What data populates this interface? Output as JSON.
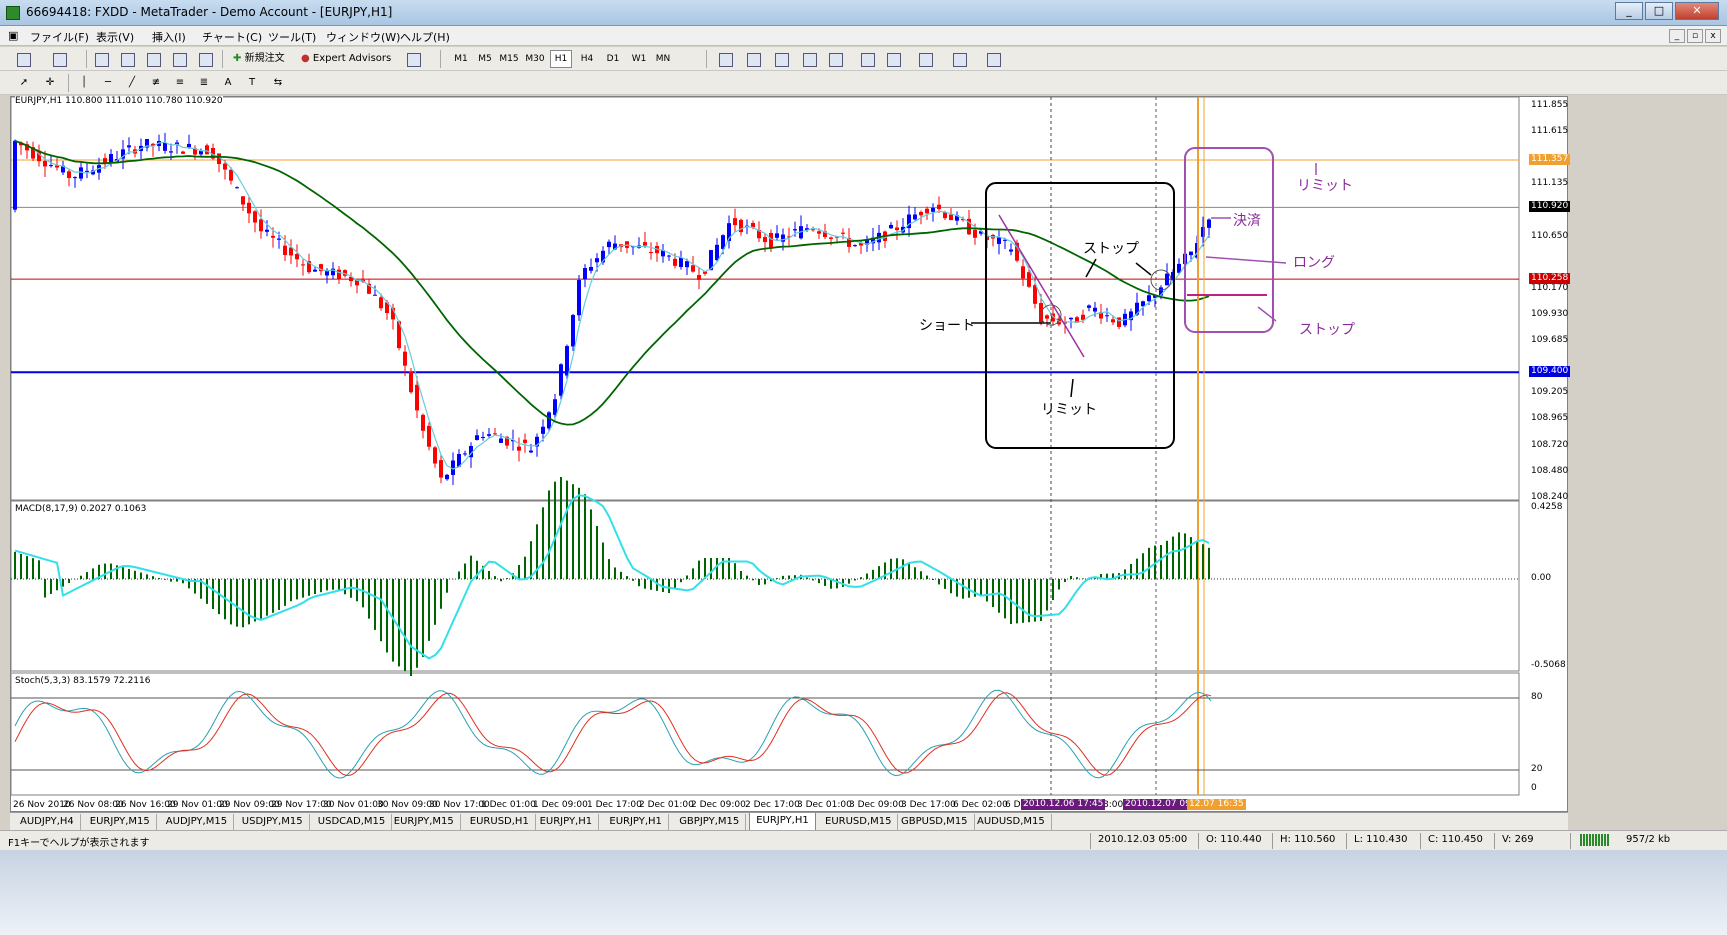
{
  "window": {
    "title": "66694418: FXDD - MetaTrader - Demo Account - [EURJPY,H1]"
  },
  "menu": [
    "ファイル(F)",
    "表示(V)",
    "挿入(I)",
    "チャート(C)",
    "ツール(T)",
    "ウィンドウ(W)",
    "ヘルプ(H)"
  ],
  "toolbar": {
    "new_order": "新規注文",
    "expert_advisors": "Expert Advisors"
  },
  "timeframes": [
    "M1",
    "M5",
    "M15",
    "M30",
    "H1",
    "H4",
    "D1",
    "W1",
    "MN"
  ],
  "chart": {
    "header": "EURJPY,H1  110.800 111.010 110.780 110.920",
    "macd_label": "MACD(8,17,9) 0.2027 0.1063",
    "stoch_label": "Stoch(5,3,3) 83.1579 72.2116",
    "price_axis": [
      "111.855",
      "111.615",
      "111.135",
      "110.650",
      "110.170",
      "109.930",
      "109.685",
      "109.205",
      "108.965",
      "108.720",
      "108.480",
      "108.240"
    ],
    "price_tags": {
      "limit": "111.357",
      "current": "110.920",
      "red": "110.258",
      "blue": "109.400"
    },
    "macd_axis": [
      "0.4258",
      "0.00",
      "-0.5068"
    ],
    "stoch_axis": [
      "80",
      "20",
      "0"
    ],
    "time_axis": [
      "26 Nov 2010",
      "26 Nov 08:00",
      "26 Nov 16:00",
      "29 Nov 01:00",
      "29 Nov 09:00",
      "29 Nov 17:00",
      "30 Nov 01:00",
      "30 Nov 09:00",
      "30 Nov 17:00",
      "1 Dec 01:00",
      "1 Dec 09:00",
      "1 Dec 17:00",
      "2 Dec 01:00",
      "2 Dec 09:00",
      "2 Dec 17:00",
      "3 Dec 01:00",
      "3 Dec 09:00",
      "3 Dec 17:00",
      "6 Dec 02:00",
      "6 D",
      "8:00",
      "7 D"
    ],
    "time_tags": [
      "2010.12.06 17:45",
      "2010.12.07 09:00",
      "12.07 16:35"
    ],
    "annotations": {
      "short": "ショート",
      "limit1": "リミット",
      "stop1": "ストップ",
      "settle": "決済",
      "long": "ロング",
      "limit2": "リミット",
      "stop2": "ストップ"
    }
  },
  "tabs": [
    "AUDJPY,H4",
    "EURJPY,M15",
    "AUDJPY,M15",
    "USDJPY,M15",
    "USDCAD,M15",
    "EURJPY,M15",
    "EURUSD,H1",
    "EURJPY,H1",
    "EURJPY,H1",
    "GBPJPY,M15",
    "EURJPY,H1",
    "EURUSD,M15",
    "GBPUSD,M15",
    "AUDUSD,M15"
  ],
  "active_tab_index": 10,
  "status": {
    "help": "F1キーでヘルプが表示されます",
    "datetime": "2010.12.03 05:00",
    "open": "O: 110.440",
    "high": "H: 110.560",
    "low": "L: 110.430",
    "close": "C: 110.450",
    "volume": "V: 269",
    "traffic": "957/2 kb"
  },
  "colors": {
    "bull": "#0000ff",
    "bear": "#ff0000",
    "ma_slow": "#006400",
    "ma_fast": "#66ccdd",
    "macd_bar": "#006400",
    "signal": "#33e0e8",
    "annot": "#8a2b9a"
  }
}
